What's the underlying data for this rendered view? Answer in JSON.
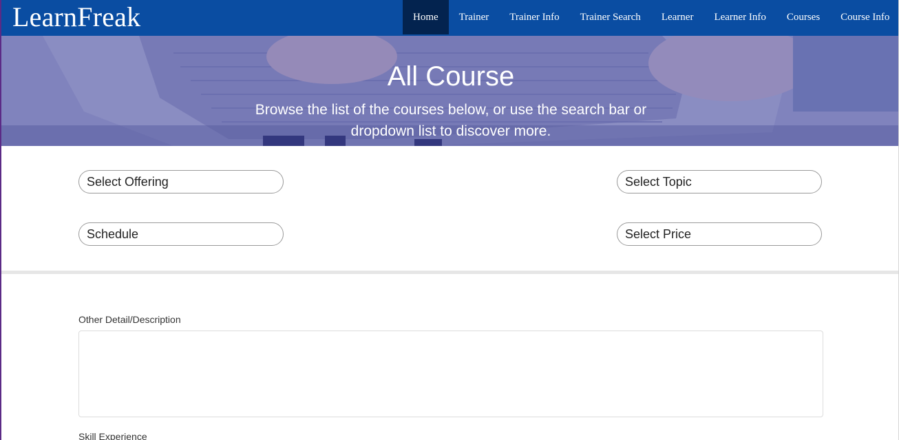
{
  "navbar": {
    "brand": "LearnFreak",
    "items": [
      {
        "label": "Home",
        "active": true
      },
      {
        "label": "Trainer",
        "active": false
      },
      {
        "label": "Trainer Info",
        "active": false
      },
      {
        "label": "Trainer Search",
        "active": false
      },
      {
        "label": "Learner",
        "active": false
      },
      {
        "label": "Learner Info",
        "active": false
      },
      {
        "label": "Courses",
        "active": false
      },
      {
        "label": "Course Info",
        "active": false
      }
    ],
    "colors": {
      "background": "#0a4da2",
      "active": "#03234f"
    }
  },
  "hero": {
    "title": "All Course",
    "subtitle": "Browse the list of the courses below, or use the search bar or dropdown list to discover more."
  },
  "filters": {
    "offering": "Select Offering",
    "topic": "Select Topic",
    "schedule": "Schedule",
    "price": "Select Price"
  },
  "form": {
    "description_label": "Other Detail/Description",
    "description_value": "",
    "skill_label": "Skill Experience"
  }
}
